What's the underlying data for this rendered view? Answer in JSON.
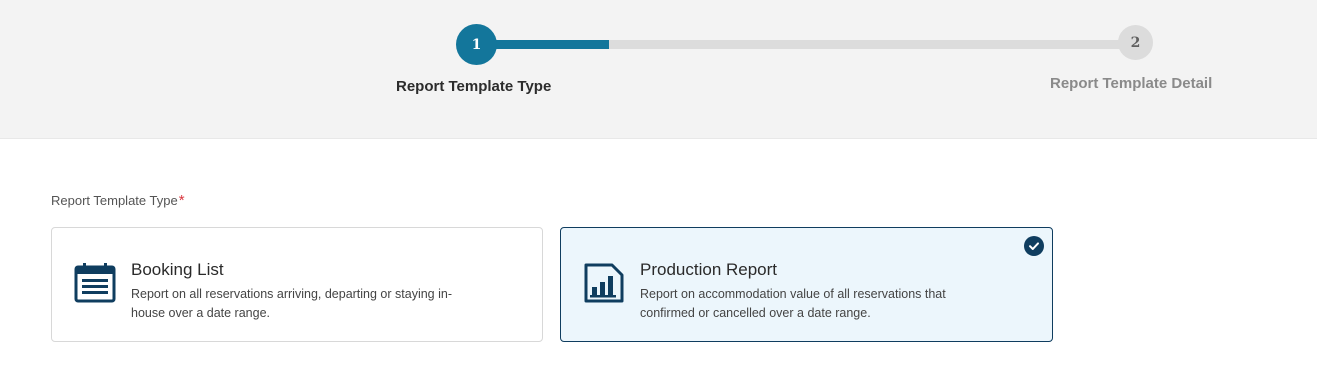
{
  "stepper": {
    "steps": [
      {
        "number": "1",
        "label": "Report Template Type",
        "state": "active"
      },
      {
        "number": "2",
        "label": "Report Template Detail",
        "state": "pending"
      }
    ],
    "progress": 0.2
  },
  "form": {
    "field_label": "Report Template Type",
    "required_mark": "*"
  },
  "options": [
    {
      "title": "Booking List",
      "description": "Report on all reservations arriving, departing or staying in-house over a date range.",
      "icon": "calendar-list-icon",
      "selected": false
    },
    {
      "title": "Production Report",
      "description": "Report on accommodation value of all reservations that confirmed or cancelled over a date range.",
      "icon": "bar-chart-icon",
      "selected": true
    }
  ],
  "colors": {
    "primary": "#13769b",
    "selected_border": "#0f3d5f",
    "selected_bg": "#ecf6fc",
    "required": "#d9363e"
  }
}
